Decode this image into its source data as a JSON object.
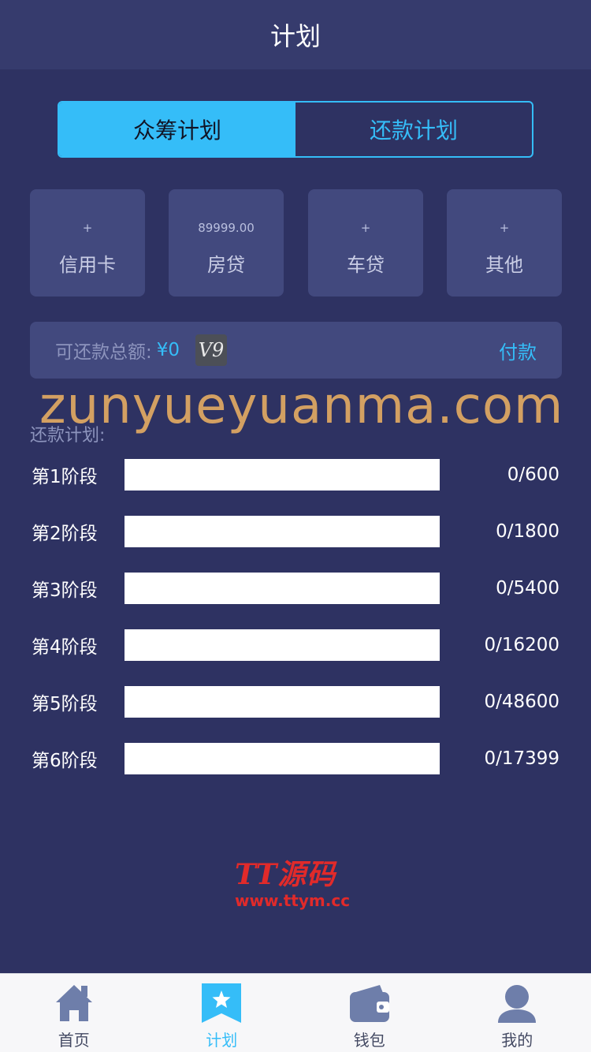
{
  "header": {
    "title": "计划"
  },
  "segments": [
    {
      "label": "众筹计划",
      "active": true
    },
    {
      "label": "还款计划",
      "active": false
    }
  ],
  "cards": [
    {
      "value": "+",
      "label": "信用卡"
    },
    {
      "value": "89999.00",
      "label": "房贷"
    },
    {
      "value": "+",
      "label": "车贷"
    },
    {
      "value": "+",
      "label": "其他"
    }
  ],
  "pay": {
    "label": "可还款总额:",
    "amount": "¥0",
    "badge": "V9",
    "button": "付款"
  },
  "watermark": "zunyueyuanma.com",
  "plan": {
    "title": "还款计划:",
    "stages": [
      {
        "label": "第1阶段",
        "value": "0/600",
        "progress": 0
      },
      {
        "label": "第2阶段",
        "value": "0/1800",
        "progress": 0
      },
      {
        "label": "第3阶段",
        "value": "0/5400",
        "progress": 0
      },
      {
        "label": "第4阶段",
        "value": "0/16200",
        "progress": 0
      },
      {
        "label": "第5阶段",
        "value": "0/48600",
        "progress": 0
      },
      {
        "label": "第6阶段",
        "value": "0/17399",
        "progress": 0
      }
    ]
  },
  "logo": {
    "line1": "TT源码",
    "line2": "www.ttym.cc"
  },
  "tabbar": {
    "items": [
      {
        "label": "首页",
        "icon": "home-icon",
        "active": false
      },
      {
        "label": "计划",
        "icon": "star-bookmark-icon",
        "active": true
      },
      {
        "label": "钱包",
        "icon": "wallet-icon",
        "active": false
      },
      {
        "label": "我的",
        "icon": "user-icon",
        "active": false
      }
    ]
  },
  "colors": {
    "accent": "#35bdf8",
    "background": "#2e3262",
    "card": "#42497e",
    "icon_inactive": "#6e7eaa"
  }
}
